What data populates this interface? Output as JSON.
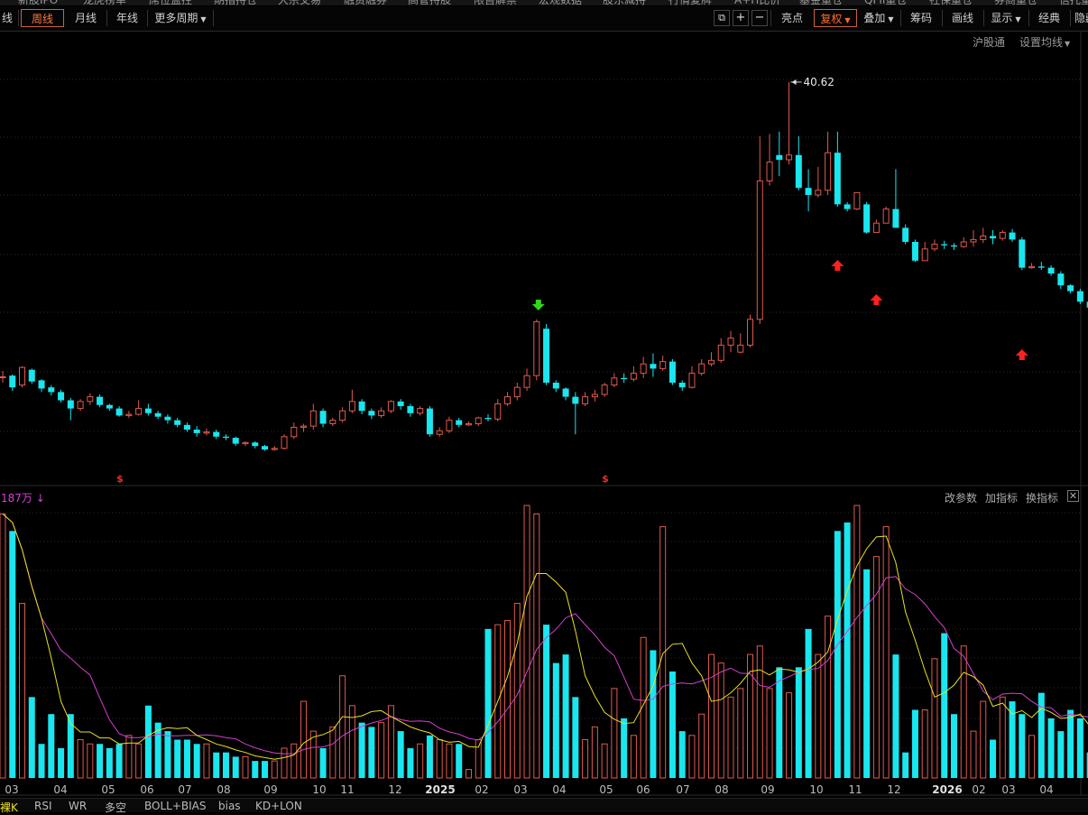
{
  "topmenu": [
    "新股IPO",
    "龙虎榜单",
    "席位监控",
    "期指持仓",
    "大宗交易",
    "融资融券",
    "高管持股",
    "限售解禁",
    "宏观数据",
    "股东减持",
    "行情复牌",
    "A+H比价",
    "基金重仓",
    "QFII重仓",
    "社保重仓",
    "券商重仓",
    "信托重仓"
  ],
  "toolbar": {
    "left": [
      "线",
      "周线",
      "月线",
      "年线",
      "更多周期"
    ],
    "right": [
      "亮点",
      "复权",
      "叠加",
      "筹码",
      "画线",
      "显示",
      "经典",
      "隐藏"
    ],
    "icons": {
      "lock": "lock-icon",
      "plus": "+",
      "minus": "−"
    }
  },
  "subbar": {
    "hk": "沪股通",
    "ma": "设置均线"
  },
  "volume_panel": {
    "label": "187万",
    "arrow": "↓",
    "buttons": [
      "改参数",
      "加指标",
      "换指标"
    ],
    "close": "✕"
  },
  "indicators": [
    "裸K",
    "RSI",
    "WR",
    "多空",
    "BOLL+BIAS",
    "bias",
    "KD+LON"
  ],
  "colors": {
    "up": "#e05a4f",
    "down": "#19e6ef",
    "ma1": "#e8e020",
    "ma2": "#d43fd0",
    "accent": "#ff6a2a"
  },
  "chart_data": {
    "type": "candlestick",
    "period": "weekly",
    "max_label": "40.62",
    "marker_symbol": "$",
    "x_labels": [
      "03",
      "04",
      "05",
      "06",
      "07",
      "08",
      "09",
      "10",
      "11",
      "12",
      "2025",
      "02",
      "03",
      "04",
      "05",
      "06",
      "07",
      "08",
      "09",
      "10",
      "11",
      "12",
      "2026",
      "02",
      "03",
      "04"
    ],
    "year_labels": [
      "2025",
      "2026"
    ],
    "price_ylim": [
      11,
      43
    ],
    "candles": [
      [
        15.5,
        15.5,
        16.0,
        15.0
      ],
      [
        15.6,
        14.6,
        15.7,
        14.3
      ],
      [
        14.8,
        16.3,
        16.4,
        14.6
      ],
      [
        16.1,
        15.1,
        16.2,
        14.9
      ],
      [
        15.2,
        14.5,
        15.3,
        14.2
      ],
      [
        14.6,
        14.2,
        14.8,
        13.9
      ],
      [
        14.2,
        13.5,
        14.4,
        13.3
      ],
      [
        13.5,
        12.8,
        13.7,
        11.8
      ],
      [
        12.8,
        13.4,
        13.6,
        12.6
      ],
      [
        13.4,
        13.8,
        14.1,
        13.1
      ],
      [
        13.8,
        13.1,
        14.0,
        12.9
      ],
      [
        13.1,
        12.8,
        13.2,
        12.6
      ],
      [
        12.8,
        12.2,
        13.0,
        12.1
      ],
      [
        12.2,
        12.3,
        12.6,
        12.0
      ],
      [
        12.3,
        12.8,
        13.5,
        12.2
      ],
      [
        12.8,
        12.4,
        13.2,
        12.2
      ],
      [
        12.4,
        12.1,
        12.6,
        11.9
      ],
      [
        12.1,
        11.8,
        12.3,
        11.5
      ],
      [
        11.8,
        11.4,
        12.0,
        11.2
      ],
      [
        11.4,
        11.0,
        11.6,
        10.8
      ],
      [
        11.0,
        10.7,
        11.3,
        10.4
      ],
      [
        10.7,
        10.8,
        11.1,
        10.5
      ],
      [
        10.8,
        10.4,
        11.0,
        10.2
      ],
      [
        10.4,
        10.3,
        10.6,
        10.1
      ],
      [
        10.3,
        9.8,
        10.4,
        9.6
      ],
      [
        9.8,
        9.9,
        10.0,
        9.6
      ],
      [
        9.9,
        9.6,
        10.0,
        9.4
      ],
      [
        9.6,
        9.3,
        9.7,
        9.2
      ],
      [
        9.3,
        9.4,
        9.6,
        9.2
      ],
      [
        9.4,
        10.4,
        10.6,
        9.3
      ],
      [
        10.4,
        11.2,
        11.6,
        10.2
      ],
      [
        11.2,
        11.3,
        11.5,
        10.8
      ],
      [
        11.3,
        12.6,
        13.2,
        11.0
      ],
      [
        12.6,
        11.5,
        12.8,
        11.2
      ],
      [
        11.5,
        11.8,
        12.0,
        11.3
      ],
      [
        11.8,
        12.6,
        12.9,
        11.6
      ],
      [
        12.6,
        13.4,
        14.4,
        12.4
      ],
      [
        13.4,
        12.6,
        13.6,
        12.3
      ],
      [
        12.6,
        12.2,
        12.8,
        11.9
      ],
      [
        12.2,
        12.6,
        12.9,
        12.0
      ],
      [
        12.6,
        13.4,
        13.5,
        12.4
      ],
      [
        13.4,
        13.0,
        13.6,
        12.7
      ],
      [
        13.0,
        12.4,
        13.2,
        12.1
      ],
      [
        12.4,
        12.8,
        13.0,
        12.2
      ],
      [
        12.8,
        10.6,
        13.0,
        10.4
      ],
      [
        10.6,
        10.9,
        11.2,
        10.4
      ],
      [
        10.9,
        11.8,
        12.1,
        10.7
      ],
      [
        11.8,
        11.4,
        12.0,
        11.2
      ],
      [
        11.4,
        11.5,
        11.7,
        11.3
      ],
      [
        11.5,
        12.0,
        12.1,
        11.3
      ],
      [
        12.0,
        11.9,
        12.3,
        11.7
      ],
      [
        11.9,
        13.2,
        13.6,
        11.7
      ],
      [
        13.2,
        13.8,
        14.2,
        13.0
      ],
      [
        13.8,
        14.6,
        15.0,
        13.5
      ],
      [
        14.6,
        15.6,
        16.2,
        14.3
      ],
      [
        15.6,
        20.2,
        20.4,
        15.2
      ],
      [
        19.6,
        15.0,
        20.0,
        14.8
      ],
      [
        15.0,
        14.5,
        15.2,
        14.2
      ],
      [
        14.5,
        13.8,
        14.6,
        13.5
      ],
      [
        13.8,
        13.2,
        14.2,
        10.6
      ],
      [
        13.2,
        13.8,
        14.2,
        13.0
      ],
      [
        13.8,
        14.0,
        14.4,
        13.4
      ],
      [
        14.0,
        14.8,
        15.0,
        13.8
      ],
      [
        14.8,
        15.4,
        15.8,
        14.6
      ],
      [
        15.4,
        15.3,
        15.8,
        15.0
      ],
      [
        15.3,
        15.8,
        16.4,
        15.1
      ],
      [
        15.8,
        16.6,
        17.2,
        15.4
      ],
      [
        16.6,
        16.2,
        17.5,
        15.5
      ],
      [
        16.2,
        16.8,
        17.3,
        16.0
      ],
      [
        16.8,
        15.0,
        17.0,
        14.8
      ],
      [
        15.0,
        14.6,
        15.2,
        14.3
      ],
      [
        14.6,
        15.8,
        16.4,
        14.5
      ],
      [
        15.8,
        16.6,
        17.0,
        15.6
      ],
      [
        16.6,
        16.9,
        17.6,
        16.4
      ],
      [
        16.9,
        18.2,
        18.8,
        16.7
      ],
      [
        18.2,
        18.8,
        19.4,
        17.6
      ],
      [
        17.6,
        18.2,
        19.2,
        17.5
      ],
      [
        18.2,
        20.4,
        20.8,
        18.0
      ],
      [
        20.4,
        32.2,
        36.0,
        20.0
      ],
      [
        32.2,
        33.8,
        36.2,
        31.8
      ],
      [
        34.4,
        34.0,
        36.4,
        32.6
      ],
      [
        34.0,
        34.4,
        40.2,
        33.6
      ],
      [
        34.4,
        31.6,
        36.0,
        31.4
      ],
      [
        31.6,
        31.0,
        33.2,
        29.6
      ],
      [
        31.0,
        31.4,
        33.4,
        30.8
      ],
      [
        31.4,
        34.6,
        36.4,
        31.0
      ],
      [
        34.6,
        30.2,
        36.4,
        30.0
      ],
      [
        30.2,
        29.8,
        30.4,
        29.6
      ],
      [
        29.8,
        31.2,
        31.2,
        29.7
      ],
      [
        30.2,
        27.8,
        30.4,
        27.7
      ],
      [
        27.8,
        28.6,
        28.9,
        28.0
      ],
      [
        28.6,
        29.8,
        30.0,
        28.6
      ],
      [
        29.8,
        28.2,
        33.2,
        28.2
      ],
      [
        28.2,
        27.0,
        28.5,
        26.8
      ],
      [
        27.0,
        25.4,
        27.2,
        25.3
      ],
      [
        25.4,
        26.4,
        27.0,
        25.4
      ],
      [
        26.4,
        26.8,
        27.2,
        26.2
      ],
      [
        26.8,
        26.7,
        27.1,
        26.4
      ],
      [
        26.7,
        26.6,
        26.9,
        26.3
      ],
      [
        26.6,
        27.0,
        27.4,
        26.5
      ],
      [
        27.0,
        27.2,
        28.0,
        26.6
      ],
      [
        27.2,
        27.5,
        28.2,
        26.9
      ],
      [
        27.5,
        27.3,
        28.0,
        26.8
      ],
      [
        27.3,
        27.8,
        28.0,
        27.1
      ],
      [
        27.8,
        27.2,
        28.1,
        27.0
      ],
      [
        27.2,
        24.8,
        27.4,
        24.6
      ],
      [
        24.8,
        24.9,
        25.2,
        24.7
      ],
      [
        24.9,
        24.8,
        25.3,
        24.6
      ],
      [
        24.8,
        24.3,
        25.0,
        24.1
      ],
      [
        24.3,
        23.3,
        24.5,
        23.0
      ],
      [
        23.3,
        22.8,
        23.4,
        22.6
      ],
      [
        22.8,
        21.9,
        23.0,
        21.7
      ],
      [
        21.9,
        21.4,
        22.0,
        21.2
      ],
      [
        21.4,
        21.5,
        21.9,
        21.1
      ],
      [
        21.5,
        21.9,
        22.4,
        21.3
      ],
      [
        21.9,
        21.9,
        22.3,
        21.6
      ],
      [
        21.9,
        22.1,
        22.3,
        21.7
      ]
    ],
    "volumes": [
      62,
      58,
      41,
      19,
      8,
      15,
      7,
      15,
      9,
      8,
      8,
      7,
      8,
      10,
      8,
      17,
      13,
      11,
      9,
      9,
      8,
      8,
      6,
      6,
      5,
      5,
      4,
      4,
      4,
      7,
      8,
      18,
      11,
      7,
      12,
      24,
      17,
      13,
      12,
      13,
      17,
      11,
      7,
      8,
      10,
      9,
      8,
      8,
      2,
      9,
      35,
      36,
      37,
      41,
      64,
      62,
      36,
      27,
      29,
      19,
      9,
      12,
      8,
      21,
      14,
      10,
      33,
      30,
      59,
      25,
      11,
      10,
      15,
      29,
      27,
      19,
      21,
      29,
      31,
      21,
      26,
      20,
      26,
      35,
      29,
      38,
      58,
      60,
      64,
      49,
      52,
      59,
      29,
      6,
      16,
      16,
      28,
      34,
      15,
      31,
      11,
      18,
      9,
      19,
      18,
      15,
      10,
      20,
      14,
      11,
      16,
      14,
      6,
      6,
      4,
      5,
      6,
      5,
      4,
      7,
      6,
      5,
      4,
      5
    ],
    "volume_up_pattern": "up_if_close_ge_open"
  }
}
